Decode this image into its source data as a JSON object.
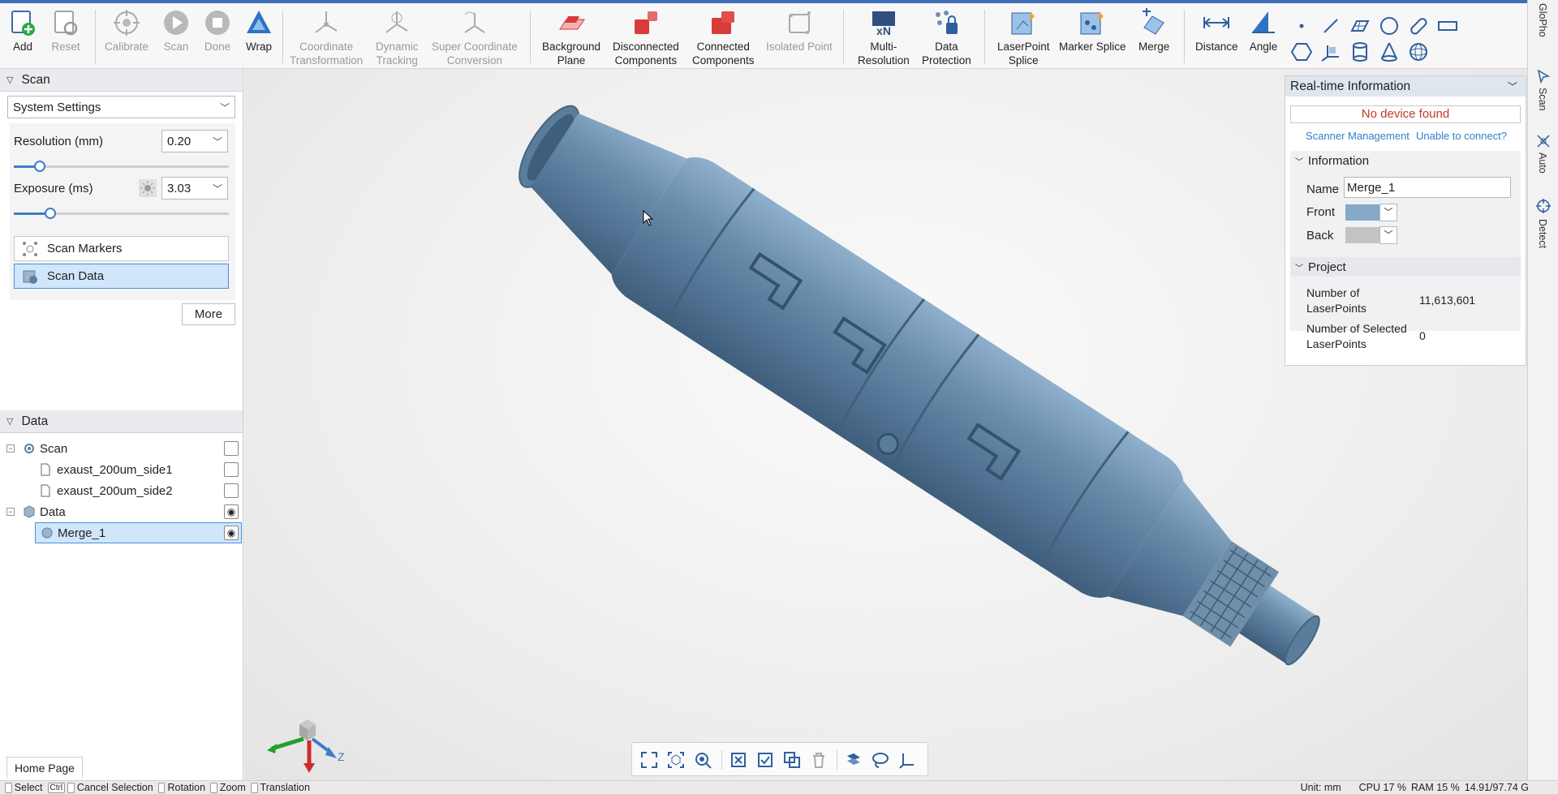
{
  "toolbar": {
    "items": [
      {
        "label": "Add",
        "icon": "add-icon"
      },
      {
        "label": "Reset",
        "icon": "reset-icon"
      },
      {
        "label": "Calibrate",
        "icon": "calibrate-icon"
      },
      {
        "label": "Scan",
        "icon": "scan-play-icon"
      },
      {
        "label": "Done",
        "icon": "stop-icon"
      },
      {
        "label": "Wrap",
        "icon": "wrap-icon"
      },
      {
        "label": "Coordinate\nTransformation",
        "icon": "axes-icon"
      },
      {
        "label": "Dynamic\nTracking",
        "icon": "tracking-icon"
      },
      {
        "label": "Super Coordinate\nConversion",
        "icon": "conversion-icon"
      },
      {
        "label": "Background\nPlane",
        "icon": "plane-icon"
      },
      {
        "label": "Disconnected\nComponents",
        "icon": "disconnected-icon"
      },
      {
        "label": "Connected\nComponents",
        "icon": "connected-icon"
      },
      {
        "label": "Isolated Point",
        "icon": "isolated-point-icon"
      },
      {
        "label": "Multi-\nResolution",
        "icon": "multi-resolution-icon"
      },
      {
        "label": "Data\nProtection",
        "icon": "data-protection-icon"
      },
      {
        "label": "LaserPoint\nSplice",
        "icon": "laserpoint-splice-icon"
      },
      {
        "label": "Marker Splice",
        "icon": "marker-splice-icon"
      },
      {
        "label": "Merge",
        "icon": "merge-icon"
      },
      {
        "label": "Distance",
        "icon": "distance-icon"
      },
      {
        "label": "Angle",
        "icon": "angle-icon"
      }
    ],
    "multi_resolution_badge": "xN"
  },
  "left": {
    "scan_header": "Scan",
    "system_settings": "System Settings",
    "resolution_label": "Resolution (mm)",
    "resolution_value": "0.20",
    "resolution_level": 0.12,
    "exposure_label": "Exposure (ms)",
    "exposure_value": "3.03",
    "exposure_level": 0.17,
    "scan_markers": "Scan Markers",
    "scan_data": "Scan Data",
    "more": "More",
    "data_header": "Data",
    "tree": {
      "scan_group": "Scan",
      "side1": "exaust_200um_side1",
      "side2": "exaust_200um_side2",
      "data_group": "Data",
      "merge": "Merge_1"
    },
    "home_tab": "Home Page"
  },
  "info": {
    "header": "Real-time Information",
    "no_device": "No device found",
    "scanner_management": "Scanner Management",
    "unable_connect": "Unable to connect?",
    "information_header": "Information",
    "name_label": "Name",
    "name_value": "Merge_1",
    "front_label": "Front",
    "front_color": "#86a9c9",
    "back_label": "Back",
    "back_color": "#c3c3c3",
    "project_header": "Project",
    "num_points_label": "Number of\nLaserPoints",
    "num_points_value": "11,613,601",
    "num_selected_label": "Number of Selected\nLaserPoints",
    "num_selected_value": "0"
  },
  "rail": {
    "tab1": "GloPho",
    "tab2": "Scan",
    "tab3": "Auto",
    "tab4": "Detect"
  },
  "axis": {
    "z_label": "Z"
  },
  "status": {
    "select": "Select",
    "ctrl": "Ctrl",
    "cancel": "Cancel Selection",
    "rotation": "Rotation",
    "zoom": "Zoom",
    "translation": "Translation",
    "unit": "Unit: mm",
    "cpu": "CPU 17 %",
    "ram": "RAM 15 %",
    "disk": "14.91/97.74 G"
  },
  "colors": {
    "accent": "#3f7cc8",
    "model": "#5c7f9e",
    "error": "#c0392b"
  }
}
